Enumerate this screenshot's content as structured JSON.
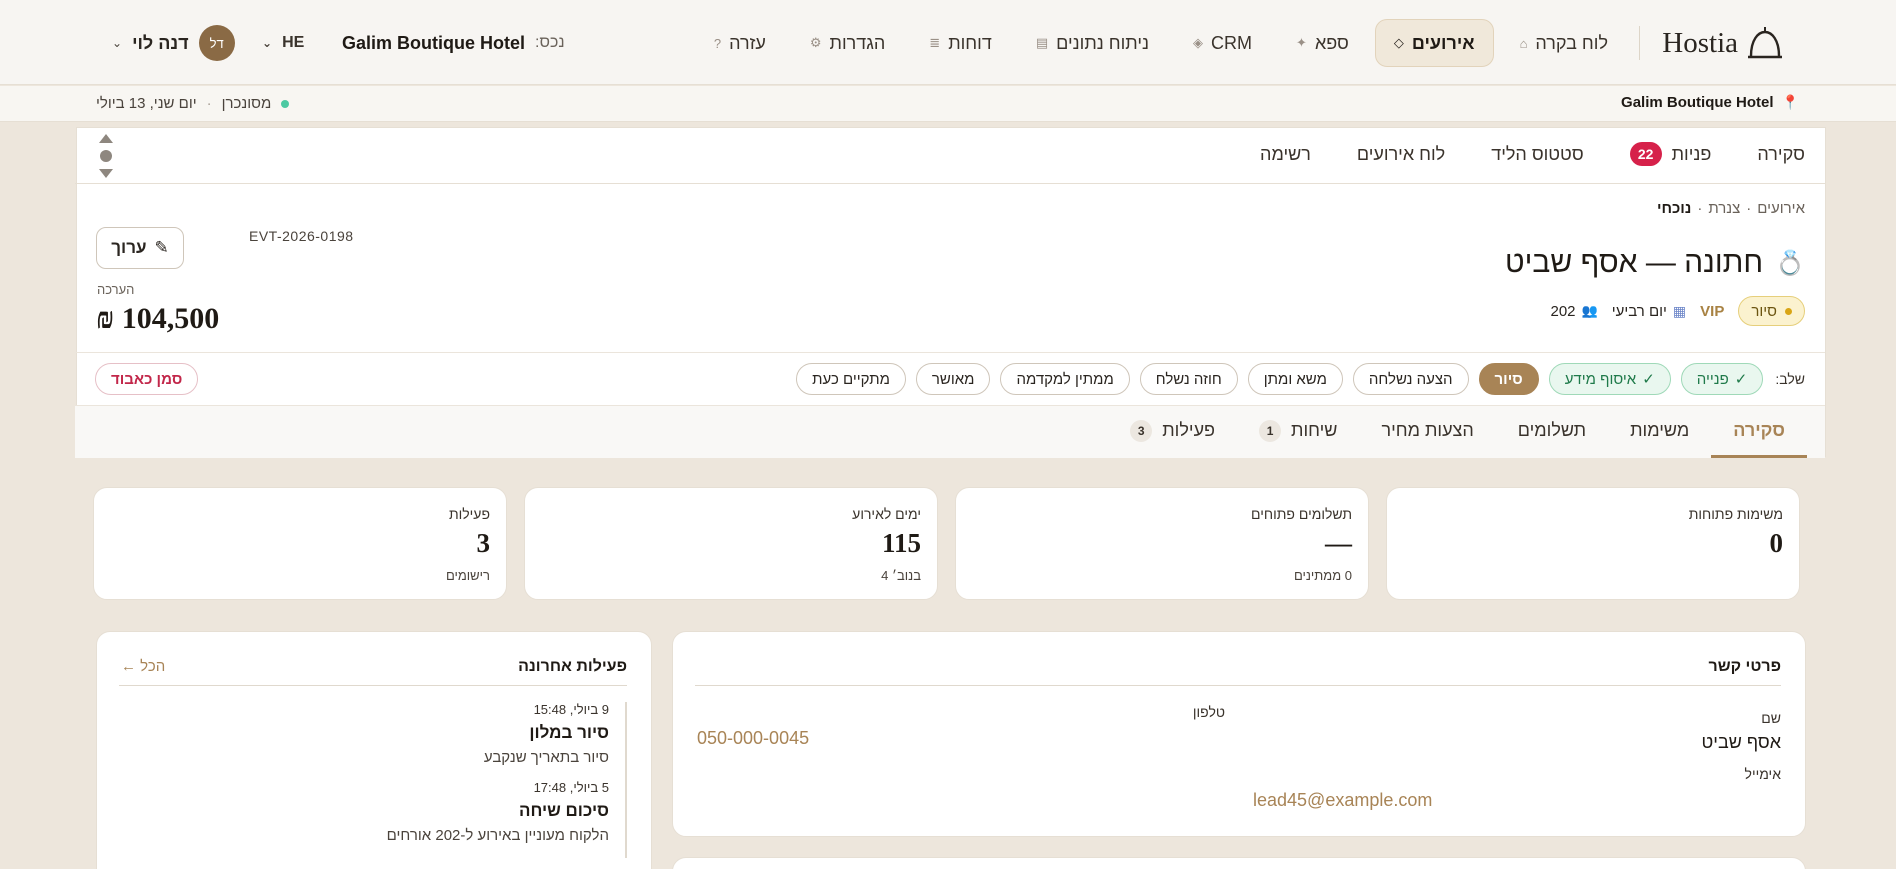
{
  "brand": {
    "name": "Hostia"
  },
  "nav": {
    "items": [
      {
        "label": "לוח בקרה",
        "icon": "⌂",
        "icon_name": "home-icon",
        "active": false
      },
      {
        "label": "אירועים",
        "icon": "◇",
        "icon_name": "diamond-icon",
        "active": true
      },
      {
        "label": "ספא",
        "icon": "✦",
        "icon_name": "sparkle-icon",
        "active": false
      },
      {
        "label": "CRM",
        "icon": "◈",
        "icon_name": "crm-icon",
        "active": false
      },
      {
        "label": "ניתוח נתונים",
        "icon": "▤",
        "icon_name": "analytics-icon",
        "active": false
      },
      {
        "label": "דוחות",
        "icon": "≣",
        "icon_name": "reports-icon",
        "active": false
      },
      {
        "label": "הגדרות",
        "icon": "⚙",
        "icon_name": "gear-icon",
        "active": false
      },
      {
        "label": "עזרה",
        "icon": "?",
        "icon_name": "help-icon",
        "active": false
      }
    ],
    "property_label": "נכס:",
    "property_value": "Galim Boutique Hotel",
    "language": "HE",
    "user_initials": "דל",
    "user_name": "דנה לוי"
  },
  "subbar": {
    "location": "Galim Boutique Hotel",
    "sync_status": "מסונכרן",
    "date": "יום שני, 13 ביולי"
  },
  "subtabs": {
    "items": [
      {
        "label": "סקירה"
      },
      {
        "label": "פניות",
        "badge": "22"
      },
      {
        "label": "סטטוס הליד"
      },
      {
        "label": "לוח אירועים"
      },
      {
        "label": "רשימה"
      }
    ]
  },
  "event": {
    "breadcrumb": [
      "אירועים",
      "צנרת",
      "נוכחי"
    ],
    "title": "חתונה — אסף שביט",
    "status": "סיור",
    "vip": "VIP",
    "day": "יום רביעי",
    "guests": "202",
    "code": "EVT-2026-0198",
    "edit_label": "ערוך",
    "estimate_label": "הערכה",
    "estimate_value": "104,500 ₪"
  },
  "stages": {
    "label": "שלב:",
    "items": [
      {
        "label": "פנייה",
        "state": "done"
      },
      {
        "label": "איסוף מידע",
        "state": "done"
      },
      {
        "label": "סיור",
        "state": "current"
      },
      {
        "label": "הצעה נשלחה",
        "state": "todo"
      },
      {
        "label": "משא ומתן",
        "state": "todo"
      },
      {
        "label": "חוזה נשלח",
        "state": "todo"
      },
      {
        "label": "ממתין למקדמה",
        "state": "todo"
      },
      {
        "label": "מאושר",
        "state": "todo"
      },
      {
        "label": "מתקיים כעת",
        "state": "todo"
      }
    ],
    "lost_label": "סמן כאבוד"
  },
  "tabs": {
    "items": [
      {
        "label": "סקירה",
        "active": true
      },
      {
        "label": "משימות"
      },
      {
        "label": "תשלומים"
      },
      {
        "label": "הצעות מחיר"
      },
      {
        "label": "שיחות",
        "count": "1"
      },
      {
        "label": "פעילות",
        "count": "3"
      }
    ]
  },
  "stats": [
    {
      "label": "משימות פתוחות",
      "value": "0",
      "sub": ""
    },
    {
      "label": "תשלומים פתוחים",
      "value": "—",
      "sub": "0 ממתינים"
    },
    {
      "label": "ימים לאירוע",
      "value": "115",
      "sub": "בנוב׳ 4"
    },
    {
      "label": "פעילות",
      "value": "3",
      "sub": "רישומים"
    }
  ],
  "contact": {
    "title": "פרטי קשר",
    "name_label": "שם",
    "name_value": "אסף שביט",
    "phone_label": "טלפון",
    "phone_value": "050-000-0045",
    "email_label": "אימייל",
    "email_value": "lead45@example.com"
  },
  "activity": {
    "title": "פעילות אחרונה",
    "all_label": "הכל ←",
    "items": [
      {
        "time": "9 ביולי, 15:48",
        "title": "סיור במלון",
        "desc": "סיור בתאריך שנקבע"
      },
      {
        "time": "5 ביולי, 17:48",
        "title": "סיכום שיחה",
        "desc": "הלקוח מעוניין באירוע ל-202 אורחים"
      }
    ]
  }
}
